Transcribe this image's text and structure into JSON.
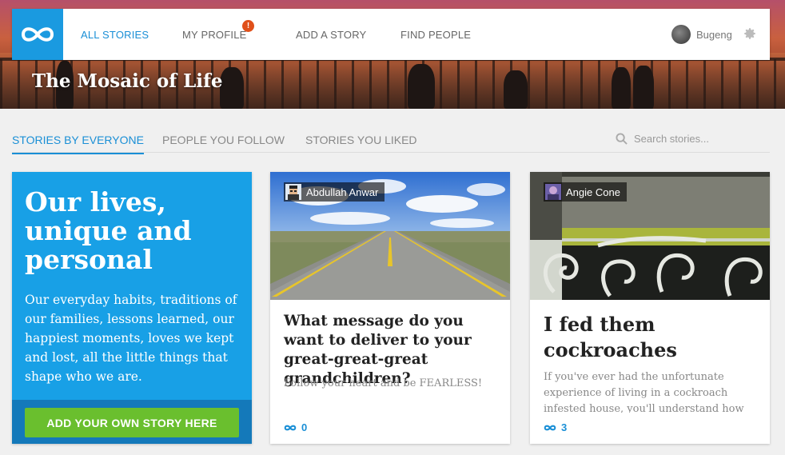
{
  "app": {
    "banner_title": "The Mosaic of Life",
    "brand_color": "#1a9ae0",
    "logo_icon": "infinity-icon"
  },
  "nav": {
    "items": [
      {
        "label": "ALL STORIES",
        "active": true
      },
      {
        "label": "MY PROFILE",
        "badge": "!"
      },
      {
        "label": "ADD A STORY"
      },
      {
        "label": "FIND PEOPLE"
      }
    ],
    "user": {
      "name": "Bugeng",
      "settings_icon": "gear-icon"
    }
  },
  "tabs": {
    "items": [
      {
        "label": "STORIES BY EVERYONE",
        "active": true
      },
      {
        "label": "PEOPLE YOU FOLLOW"
      },
      {
        "label": "STORIES YOU LIKED"
      }
    ],
    "search_placeholder": "Search stories..."
  },
  "promo": {
    "heading": "Our lives, unique and personal",
    "text": "Our everyday habits, traditions of our families, lessons learned, our happiest moments, loves we kept and lost, all the little things that shape who we are.",
    "cta_label": "ADD YOUR OWN STORY HERE",
    "cta_color": "#6abf2e"
  },
  "stories": [
    {
      "author": "Abdullah Anwar",
      "title": "What message do you want to deliver to your great-great-great grandchildren?",
      "excerpt": "Follow your heart and be FEARLESS!",
      "likes": "0"
    },
    {
      "author": "Angie Cone",
      "title": "I fed them cockroaches",
      "excerpt": "If you've ever had the unfortunate experience of living in a cockroach infested house, you'll understand how",
      "likes": "3"
    }
  ]
}
